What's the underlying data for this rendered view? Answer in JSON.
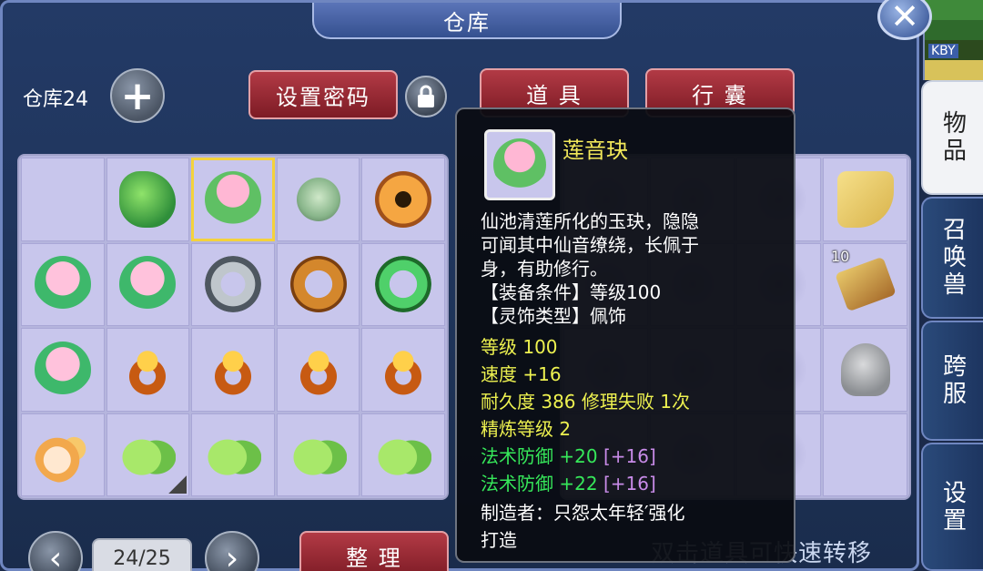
{
  "window": {
    "title": "仓库",
    "close_icon": "close-icon"
  },
  "side_tabs": [
    {
      "label": "物品",
      "active": true
    },
    {
      "label": "召唤兽",
      "active": false
    },
    {
      "label": "跨服",
      "active": false
    },
    {
      "label": "设置",
      "active": false
    }
  ],
  "minimap": {
    "label": "KBY"
  },
  "toolbar": {
    "store_label": "仓库24",
    "add_icon": "plus-icon",
    "set_password_label": "设置密码",
    "lock_icon": "lock-icon"
  },
  "tabs": [
    {
      "label": "道 具",
      "active": true
    },
    {
      "label": "行 囊",
      "active": false
    }
  ],
  "grid_left": [
    {
      "icon": "empty-slot"
    },
    {
      "icon": "leaf-charm-icon"
    },
    {
      "icon": "lotus-jade-icon",
      "selected": true
    },
    {
      "icon": "jade-pendant-icon"
    },
    {
      "icon": "amulet-icon"
    },
    {
      "icon": "pink-flower-jade-icon"
    },
    {
      "icon": "pink-flower-jade-icon"
    },
    {
      "icon": "silver-ring-icon"
    },
    {
      "icon": "wood-ring-icon"
    },
    {
      "icon": "green-ring-icon"
    },
    {
      "icon": "pink-flower-jade-icon"
    },
    {
      "icon": "orange-flower-ring-icon"
    },
    {
      "icon": "orange-flower-ring-icon"
    },
    {
      "icon": "orange-flower-ring-icon"
    },
    {
      "icon": "orange-flower-ring-icon"
    },
    {
      "icon": "pearl-earring-icon"
    },
    {
      "icon": "green-leaf-earring-icon"
    },
    {
      "icon": "green-leaf-earring-icon"
    },
    {
      "icon": "green-leaf-earring-icon"
    },
    {
      "icon": "green-leaf-earring-icon"
    }
  ],
  "grid_right": [
    {
      "icon": "faded-item-icon"
    },
    {
      "icon": "faded-item-icon"
    },
    {
      "icon": "faded-item-icon"
    },
    {
      "icon": "fan-icon"
    },
    {
      "icon": "faded-item-icon"
    },
    {
      "icon": "faded-item-icon"
    },
    {
      "icon": "faded-item-icon"
    },
    {
      "icon": "scroll-icon",
      "count": "10"
    },
    {
      "icon": "faded-item-icon"
    },
    {
      "icon": "faded-item-icon"
    },
    {
      "icon": "faded-item-icon"
    },
    {
      "icon": "stone-icon"
    },
    {
      "icon": "faded-item-icon"
    },
    {
      "icon": "faded-item-icon"
    },
    {
      "icon": "faded-item-icon"
    },
    {
      "icon": "empty-slot"
    }
  ],
  "pager": {
    "prev_icon": "chevron-left-icon",
    "next_icon": "chevron-right-icon",
    "page": "24/25"
  },
  "sort_label": "整 理",
  "hint": "双击道具可快速转移",
  "tooltip": {
    "name": "莲音玦",
    "desc_lines": [
      "仙池清莲所化的玉玦，隐隐",
      "可闻其中仙音缭绕，长佩于",
      "身，有助修行。",
      "【装备条件】等级100",
      "【灵饰类型】佩饰"
    ],
    "stats": {
      "level": "等级 100",
      "speed": "速度 +16",
      "durability": "耐久度 386  修理失败 1次",
      "refine": "精炼等级 2",
      "magic_def_1": "法术防御 +20",
      "magic_def_1_bonus": "[+16]",
      "magic_def_2": "法术防御 +22",
      "magic_def_2_bonus": "[+16]",
      "maker_1": "制造者：只怨太年轻′强化",
      "maker_2": "打造"
    }
  }
}
